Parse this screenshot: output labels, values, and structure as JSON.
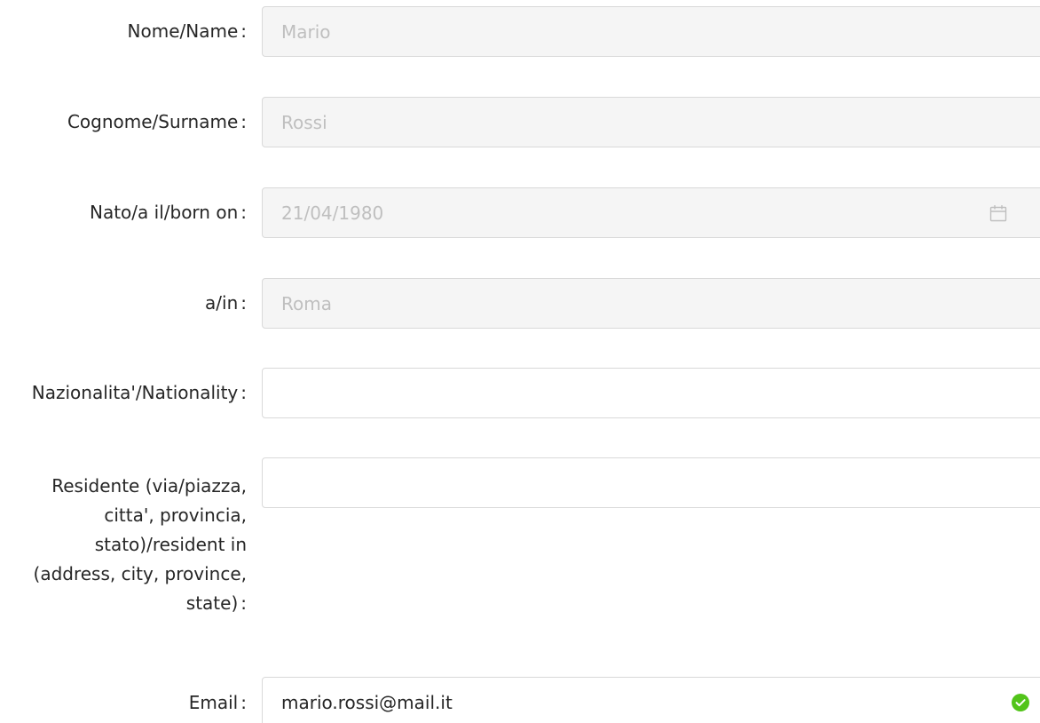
{
  "form": {
    "name": {
      "label": "Nome/Name",
      "value": "Mario"
    },
    "surname": {
      "label": "Cognome/Surname",
      "value": "Rossi"
    },
    "born_on": {
      "label": "Nato/a il/born on",
      "value": "21/04/1980"
    },
    "born_in": {
      "label": "a/in",
      "value": "Roma"
    },
    "nationality": {
      "label": "Nazionalita'/Nationality",
      "value": ""
    },
    "residence": {
      "label_lines": [
        "Residente (via/piazza,",
        "citta', provincia,",
        "stato)/resident in",
        "(address, city, province,",
        "state)"
      ],
      "value": ""
    },
    "email": {
      "label": "Email",
      "value": "mario.rossi@mail.it"
    },
    "colon": ":",
    "colors": {
      "disabled_bg": "#f5f5f5",
      "disabled_text": "#bfbfbf",
      "border": "#d9d9d9",
      "success": "#52c41a"
    },
    "icons": {
      "date": "calendar-icon",
      "valid": "check-circle-icon"
    }
  }
}
